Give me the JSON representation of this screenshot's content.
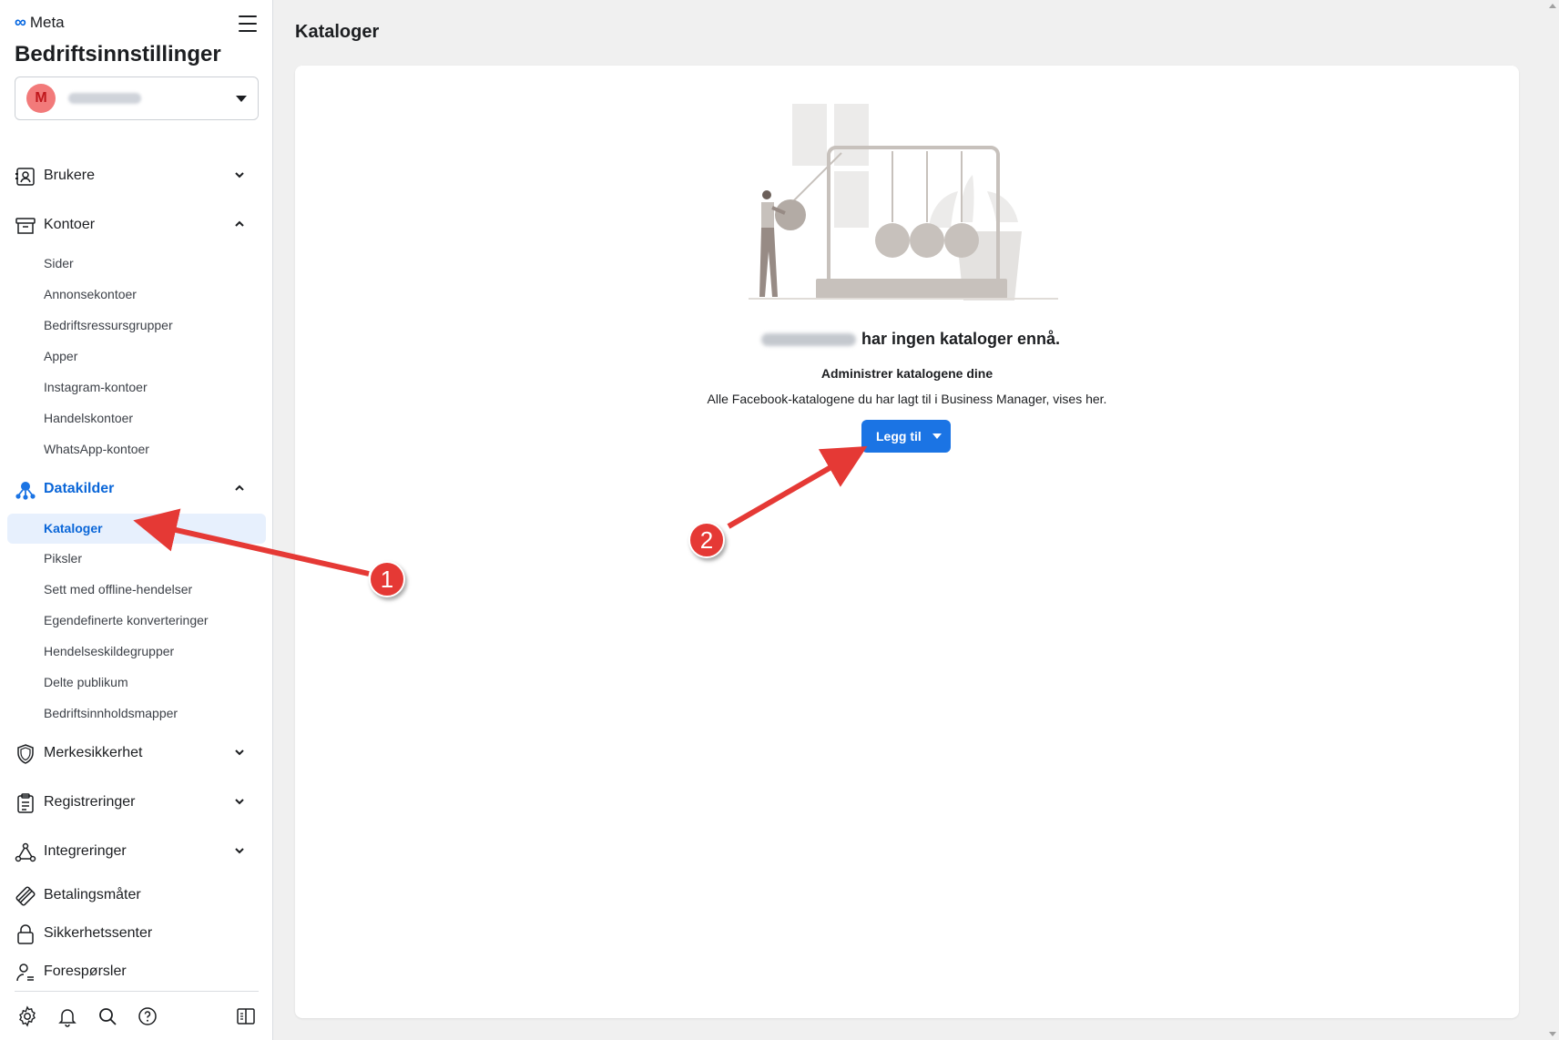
{
  "sidebar": {
    "logo_text": "Meta",
    "app_title": "Bedriftsinnstillinger",
    "business": {
      "avatar_letter": "M"
    },
    "groups": {
      "brukere": {
        "label": "Brukere"
      },
      "kontoer": {
        "label": "Kontoer",
        "items": [
          "Sider",
          "Annonsekontoer",
          "Bedriftsressursgrupper",
          "Apper",
          "Instagram-kontoer",
          "Handelskontoer",
          "WhatsApp-kontoer"
        ]
      },
      "datakilder": {
        "label": "Datakilder",
        "active_item": "Kataloger",
        "items": [
          "Piksler",
          "Sett med offline-hendelser",
          "Egendefinerte konverteringer",
          "Hendelseskildegrupper",
          "Delte publikum",
          "Bedriftsinnholdsmapper"
        ]
      },
      "merkesikkerhet": {
        "label": "Merkesikkerhet"
      },
      "registreringer": {
        "label": "Registreringer"
      },
      "integreringer": {
        "label": "Integreringer"
      },
      "betalingsmater": {
        "label": "Betalingsmåter"
      },
      "sikkerhetssenter": {
        "label": "Sikkerhetssenter"
      },
      "foresporsler": {
        "label": "Forespørsler"
      }
    },
    "bottom_icons": [
      "gear-icon",
      "bell-icon",
      "search-icon",
      "help-icon",
      "panel-toggle-icon"
    ]
  },
  "main": {
    "title": "Kataloger",
    "empty_state": {
      "title_suffix": "har ingen kataloger ennå.",
      "subtitle": "Administrer katalogene dine",
      "description": "Alle Facebook-katalogene du har lagt til i Business Manager, vises her.",
      "add_button": "Legg til"
    }
  },
  "annotations": {
    "badge1": "1",
    "badge2": "2",
    "color": "#e53935"
  },
  "colors": {
    "accent": "#1b74e4",
    "active_text": "#0a66d8",
    "active_bg": "#e7f0fd"
  }
}
